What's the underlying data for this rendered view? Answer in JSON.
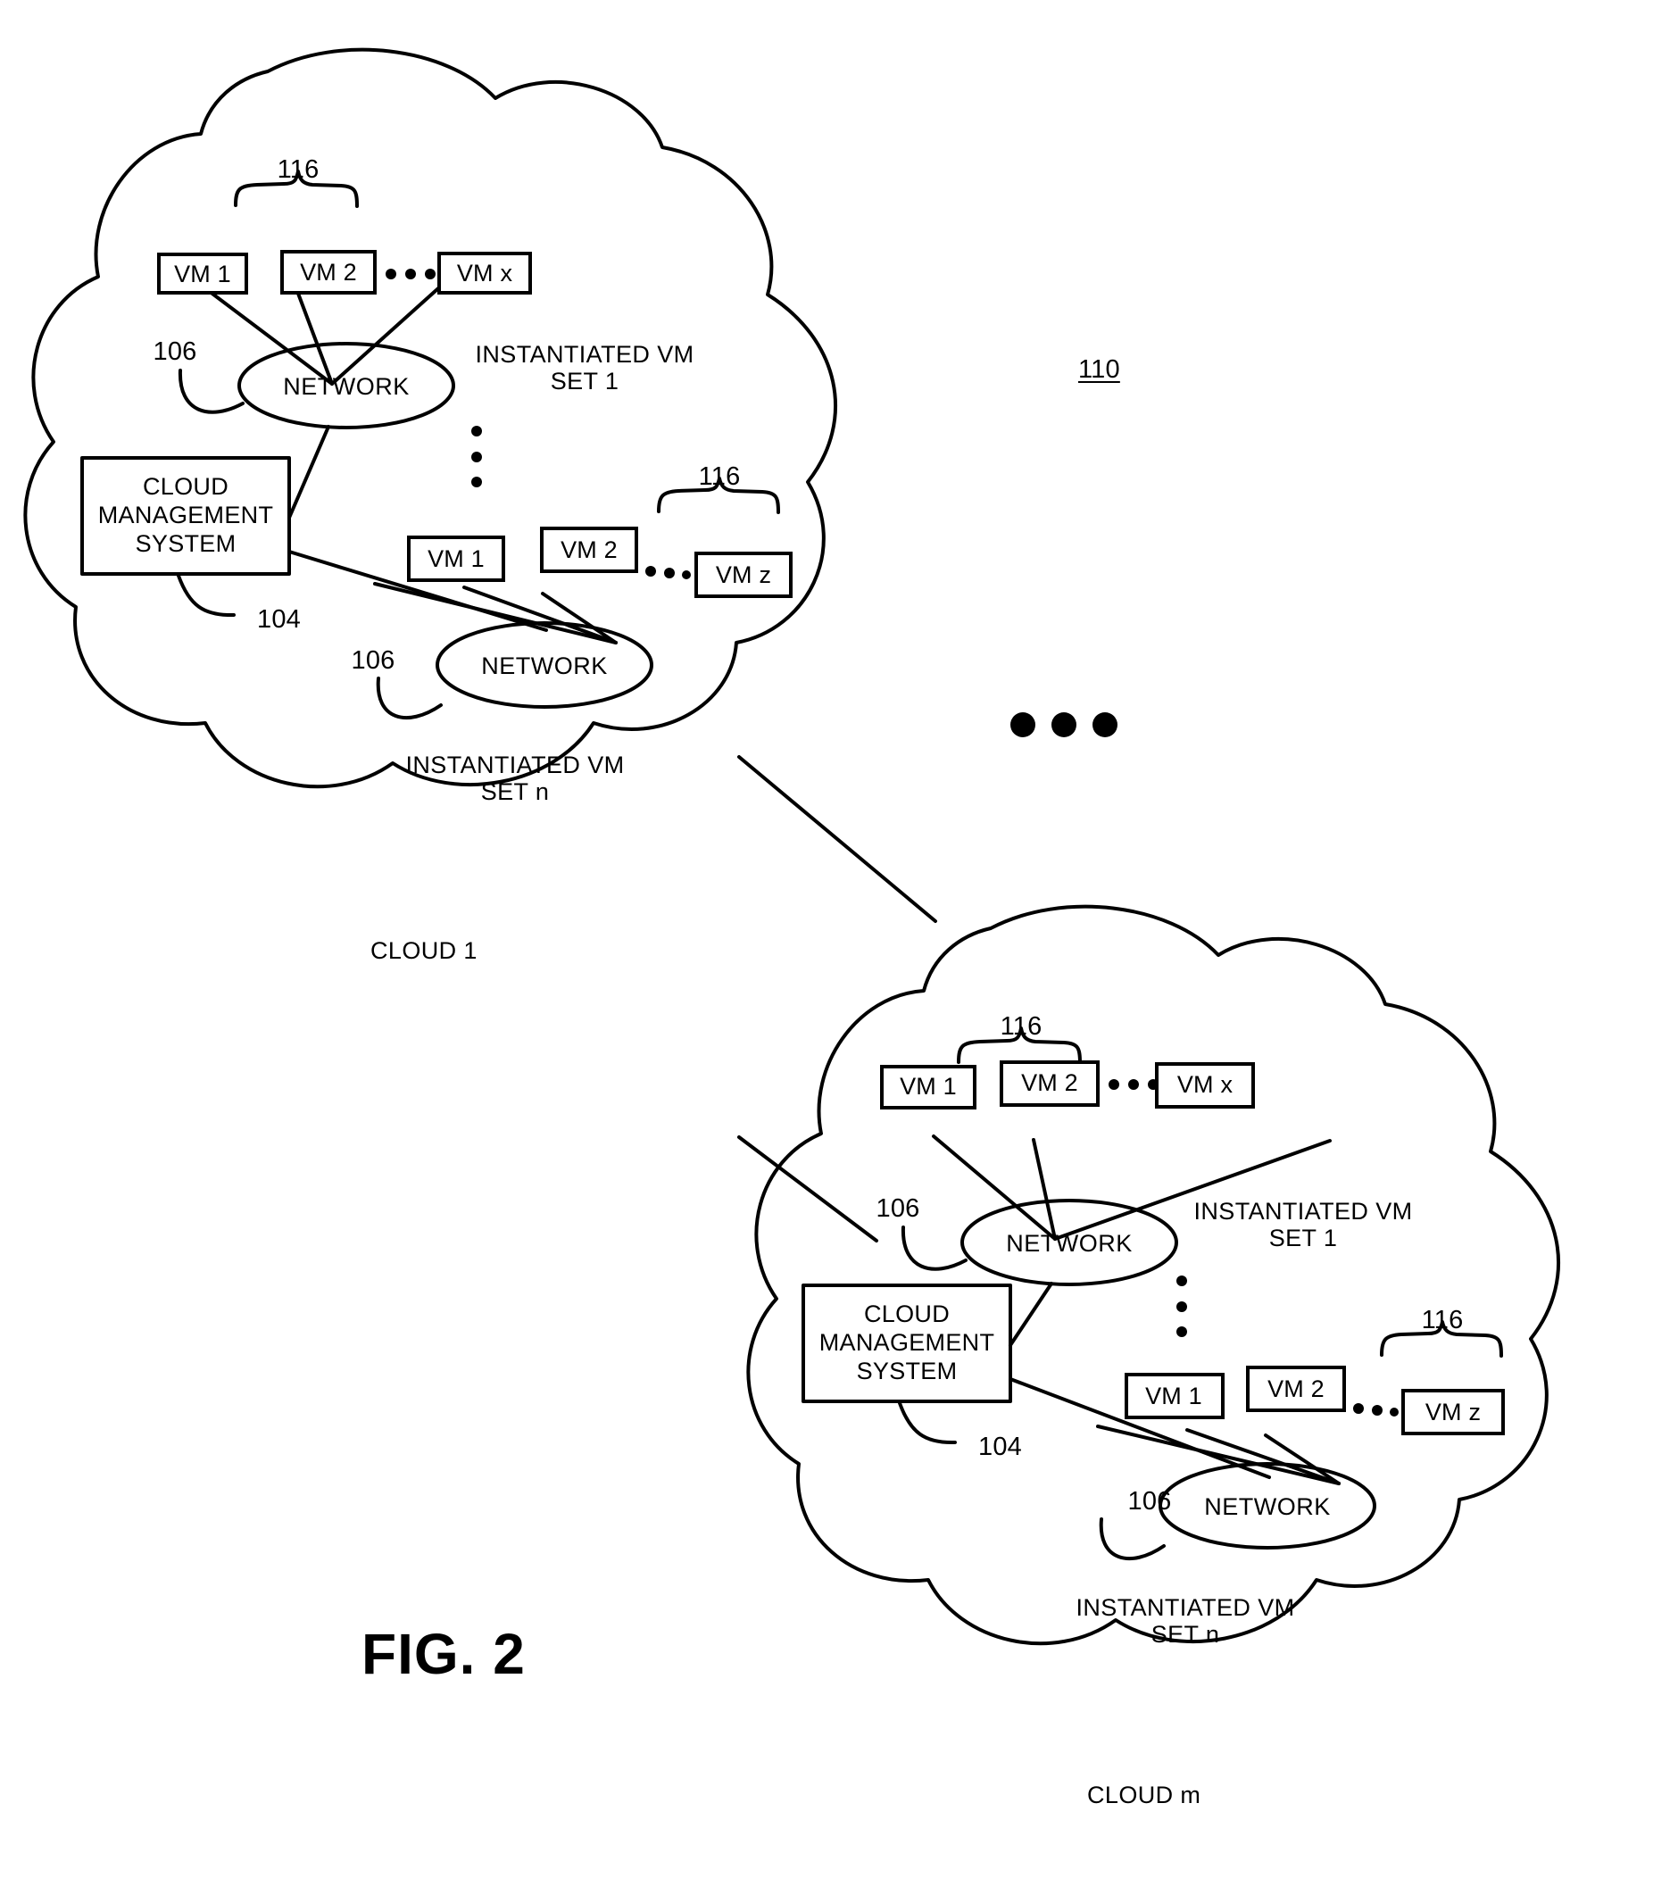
{
  "figure": {
    "caption": "FIG. 2",
    "system_ref": "110"
  },
  "clouds": [
    {
      "name": "CLOUD 1",
      "management_system": {
        "label": "CLOUD\nMANAGEMENT\nSYSTEM",
        "ref": "104"
      },
      "vm_sets": [
        {
          "set_label": "INSTANTIATED VM\nSET 1",
          "bracket_ref": "116",
          "network_label": "NETWORK",
          "network_ref": "106",
          "vms": [
            "VM 1",
            "VM 2",
            "VM x"
          ],
          "ellipsis": "• • •"
        },
        {
          "set_label": "INSTANTIATED VM\nSET n",
          "bracket_ref": "116",
          "network_label": "NETWORK",
          "network_ref": "106",
          "vms": [
            "VM 1",
            "VM 2",
            "VM z"
          ],
          "ellipsis": "• • •"
        }
      ],
      "vertical_ellipsis": "⋮"
    },
    {
      "name": "CLOUD m",
      "management_system": {
        "label": "CLOUD\nMANAGEMENT\nSYSTEM",
        "ref": "104"
      },
      "vm_sets": [
        {
          "set_label": "INSTANTIATED VM\nSET 1",
          "bracket_ref": "116",
          "network_label": "NETWORK",
          "network_ref": "106",
          "vms": [
            "VM 1",
            "VM 2",
            "VM x"
          ],
          "ellipsis": "• • •"
        },
        {
          "set_label": "INSTANTIATED VM\nSET n",
          "bracket_ref": "116",
          "network_label": "NETWORK",
          "network_ref": "106",
          "vms": [
            "VM 1",
            "VM 2",
            "VM z"
          ],
          "ellipsis": "• • •"
        }
      ],
      "vertical_ellipsis": "⋮"
    }
  ],
  "between_clouds_ellipsis": "• • •",
  "colors": {
    "stroke": "#000000",
    "background": "#ffffff"
  }
}
